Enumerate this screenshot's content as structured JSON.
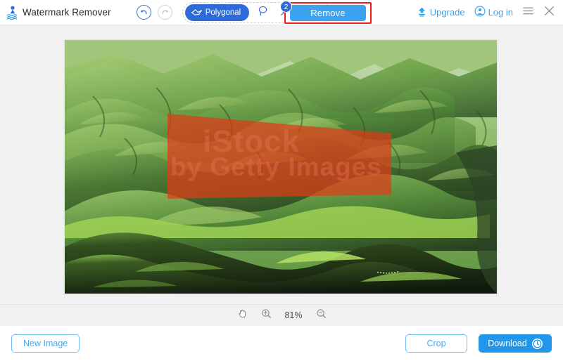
{
  "app": {
    "title": "Watermark Remover",
    "logo_icon": "watermark-logo-icon"
  },
  "header": {
    "undo_icon": "undo-arrow-icon",
    "redo_icon": "redo-arrow-icon",
    "tools": {
      "active_tool_label": "Polygonal",
      "active_tool_icon": "polygonal-lasso-icon",
      "lasso_icon": "lasso-icon",
      "brush_icon": "brush-icon",
      "eraser_icon": "eraser-icon"
    },
    "step_badge": "2",
    "remove_label": "Remove",
    "upgrade_label": "Upgrade",
    "upgrade_icon": "upload-upgrade-icon",
    "login_label": "Log in",
    "login_icon": "user-account-icon",
    "menu_icon": "hamburger-menu-icon",
    "close_icon": "close-icon"
  },
  "canvas": {
    "watermark_line1": "iStock",
    "watermark_line2": "by Getty Images",
    "selection_name": "polygonal-selection"
  },
  "zoombar": {
    "pan_icon": "hand-pan-icon",
    "zoom_in_icon": "zoom-in-icon",
    "zoom_out_icon": "zoom-out-icon",
    "zoom_value": "81%"
  },
  "footer": {
    "new_image_label": "New Image",
    "crop_label": "Crop",
    "download_label": "Download",
    "download_icon": "download-clock-icon"
  },
  "colors": {
    "brand_blue": "#2f6bd8",
    "light_blue": "#3ba3ef",
    "accent_red": "#ee1c18",
    "selection_red": "#d93a20",
    "canvas_bg": "#f1f1f1"
  }
}
